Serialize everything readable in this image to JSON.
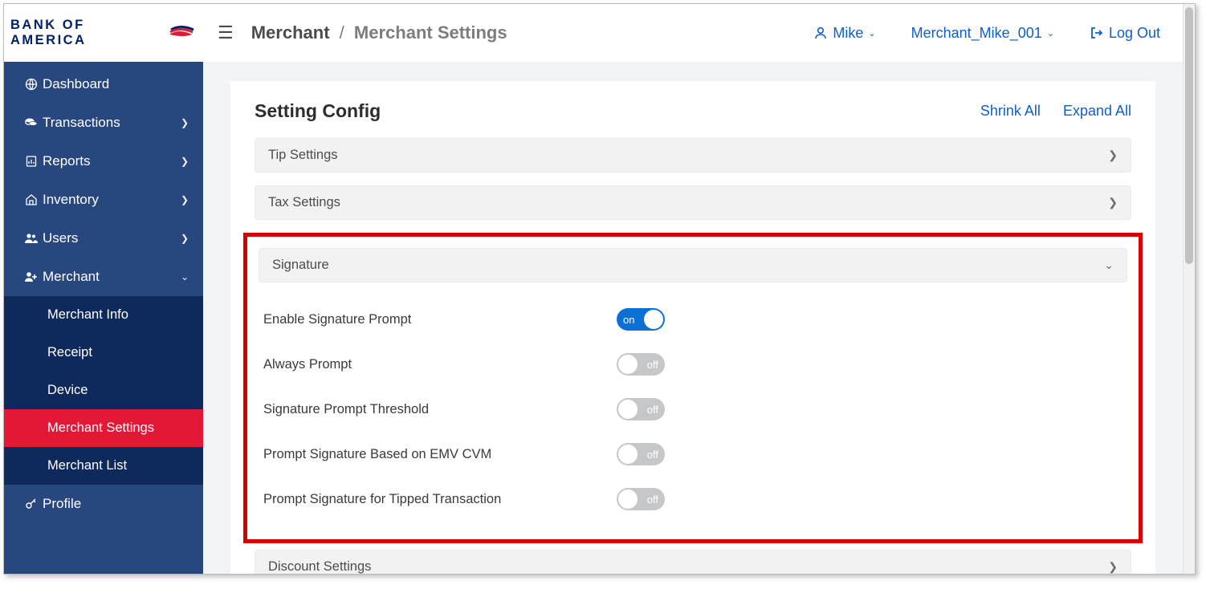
{
  "brand": {
    "name": "BANK OF AMERICA"
  },
  "sidebar": {
    "items": [
      {
        "label": "Dashboard",
        "icon": "globe",
        "expandable": false
      },
      {
        "label": "Transactions",
        "icon": "coins",
        "expandable": true
      },
      {
        "label": "Reports",
        "icon": "report",
        "expandable": true
      },
      {
        "label": "Inventory",
        "icon": "home",
        "expandable": true
      },
      {
        "label": "Users",
        "icon": "users",
        "expandable": true
      },
      {
        "label": "Merchant",
        "icon": "merchant",
        "expandable": true,
        "expanded": true
      }
    ],
    "merchant_sub": [
      {
        "label": "Merchant Info",
        "active": false
      },
      {
        "label": "Receipt",
        "active": false
      },
      {
        "label": "Device",
        "active": false
      },
      {
        "label": "Merchant Settings",
        "active": true
      },
      {
        "label": "Merchant List",
        "active": false
      }
    ],
    "profile": {
      "label": "Profile"
    }
  },
  "topbar": {
    "breadcrumb": {
      "root": "Merchant",
      "current": "Merchant Settings"
    },
    "user_name": "Mike",
    "merchant_account": "Merchant_Mike_001",
    "logout_label": "Log Out"
  },
  "panel": {
    "title": "Setting Config",
    "shrink_all": "Shrink All",
    "expand_all": "Expand All"
  },
  "sections": {
    "tip": {
      "title": "Tip Settings",
      "expanded": false
    },
    "tax": {
      "title": "Tax Settings",
      "expanded": false
    },
    "signature": {
      "title": "Signature",
      "expanded": true
    },
    "discount": {
      "title": "Discount Settings",
      "expanded": false
    }
  },
  "signature_settings": [
    {
      "label": "Enable Signature Prompt",
      "state": "on"
    },
    {
      "label": "Always Prompt",
      "state": "off"
    },
    {
      "label": "Signature Prompt Threshold",
      "state": "off"
    },
    {
      "label": "Prompt Signature Based on EMV CVM",
      "state": "off"
    },
    {
      "label": "Prompt Signature for Tipped Transaction",
      "state": "off"
    }
  ],
  "toggle_labels": {
    "on": "on",
    "off": "off"
  }
}
